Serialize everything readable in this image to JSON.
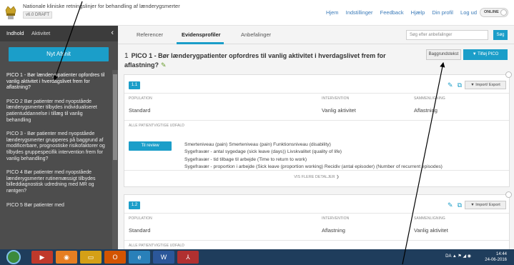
{
  "header": {
    "title": "Nationale kliniske retningslinjer for behandling af lænderygsmerter",
    "version": "v6.0  DRAFT",
    "nav": [
      "Hjem",
      "Indstillinger",
      "Feedback",
      "Hjælp",
      "Din profil",
      "Log ud"
    ],
    "toggle": "ONLINE"
  },
  "sidebar": {
    "tabs": [
      "Indhold",
      "Aktivitet"
    ],
    "collapse_icon": "chevron-left-icon",
    "new_section_label": "Nyt Afsnit",
    "items": [
      "PICO 1 - Bør lænderygpatienter opfordres til vanlig aktivitet i hverdagslivet frem for aflastning?",
      "PICO 2 Bør patienter med nyopståede lænderygsmerter tilbydes individualiseret patientuddannelse i tillæg til vanlig behandling",
      "PICO 3 - Bør patienter med nyopståede lænderygsmerter grupperes på baggrund af modificerbare, prognostiske risikofaktorer og tilbydes gruppespecifik intervention frem for vanlig behandling?",
      "PICO 4 Bør patienter med nyopståede lænderygsmerter rutinemæssigt tilbydes billeddiagnostisk udredning med MR og røntgen?",
      "PICO 5 Bør patienter med"
    ]
  },
  "main": {
    "tabs": [
      "Referencer",
      "Evidensprofiler",
      "Anbefalinger"
    ],
    "active_tab": "Evidensprofiler",
    "search_placeholder": "Søg efter anbefalinger",
    "search_button": "Søg",
    "pico_number": "1",
    "pico_title": "PICO 1 - Bør lænderygpatienter opfordres til vanlig aktivitet i hverdagslivet frem for aflastning?",
    "background_button": "Baggrundstekst",
    "add_pico_button": "▼ Tilføj PICO",
    "cards": [
      {
        "badge": "1.1",
        "import_label": "▼ Import/ Export",
        "population_label": "POPULATION",
        "population": "Standard",
        "intervention_label": "INTERVENTION",
        "intervention": "Vanlig aktivitet",
        "comparison_label": "SAMMENLIGNING",
        "comparison": "Aflastning",
        "outcomes_label": "ALLE PATIENTVIGTIGE UDFALD",
        "review_button": "Til review",
        "outcome_lines": [
          "Smerteniveau (pain)    Smerteniveau (pain)    Funktionsniveau (disability)",
          "Sygefravær - antal sygedage (sick leave (days))    Livskvalitet (quality of life)",
          "Sygefravær - tid tilbage til arbejde (Time to return to work)",
          "Sygefravær - proportion i arbejde (Sick leave (proportion working)    Recidiv (antal episoder) (Number of recurrent episodes)"
        ],
        "show_more": "VIS FLERE DETALJER"
      },
      {
        "badge": "1.2",
        "import_label": "▼ Import/ Export",
        "population_label": "POPULATION",
        "population": "Standard",
        "intervention_label": "INTERVENTION",
        "intervention": "Aflastning",
        "comparison_label": "SAMMENLIGNING",
        "comparison": "Vanlig aktivitet",
        "outcomes_label": "ALLE PATIENTVIGTIGE UDFALD"
      }
    ]
  },
  "taskbar": {
    "language": "DA",
    "time": "14:44",
    "date": "24-06-2016"
  },
  "colors": {
    "accent": "#1b9ec9",
    "sidebar_bg": "#4d4d4d",
    "taskbar_bg": "#1f3d5c",
    "edit_icon": "#6a9d2f"
  }
}
